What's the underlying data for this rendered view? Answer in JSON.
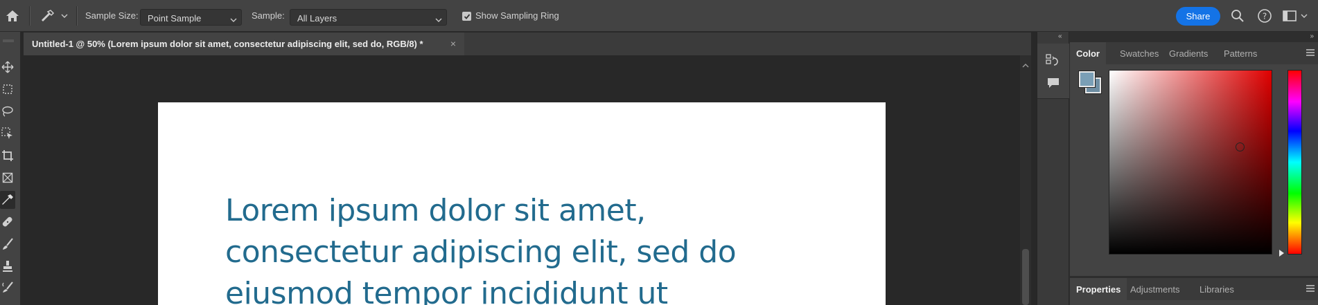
{
  "options_bar": {
    "sample_size_label": "Sample Size:",
    "sample_size_value": "Point Sample",
    "sample_label": "Sample:",
    "sample_value": "All Layers",
    "show_sampling_ring_label": "Show Sampling Ring",
    "show_sampling_ring_checked": true,
    "share_label": "Share"
  },
  "document": {
    "tab_title": "Untitled-1 @ 50% (Lorem ipsum dolor sit amet, consectetur adipiscing elit, sed do, RGB/8) *",
    "tab_close": "×",
    "text_lines": [
      "Lorem ipsum dolor sit amet,",
      "consectetur adipiscing elit, sed do",
      "eiusmod tempor incididunt ut"
    ],
    "text_color": "#226b8e"
  },
  "color_panel": {
    "tabs": [
      "Color",
      "Swatches",
      "Gradients",
      "Patterns"
    ],
    "active_tab": "Color",
    "foreground_color": "#7a9fb6",
    "background_color": "#6e8ea3"
  },
  "properties_panel": {
    "tabs": [
      "Properties",
      "Adjustments",
      "Libraries"
    ],
    "active_tab": "Properties"
  },
  "colors": {
    "accent": "#1473e6",
    "panel_bg": "#434343",
    "canvas_bg": "#282828"
  }
}
